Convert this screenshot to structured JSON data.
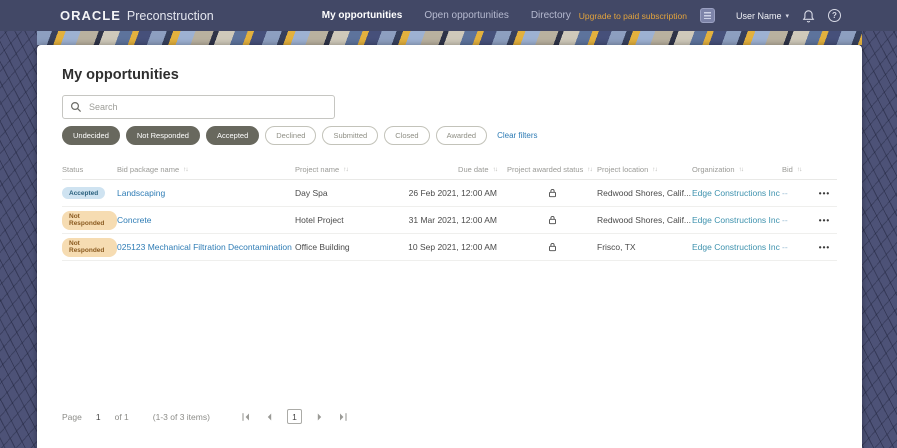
{
  "header": {
    "logo_oracle": "ORACLE",
    "logo_product": "Preconstruction",
    "nav": [
      {
        "label": "My opportunities",
        "active": true
      },
      {
        "label": "Open opportunities",
        "active": false
      },
      {
        "label": "Directory",
        "active": false
      }
    ],
    "upgrade_link": "Upgrade to paid subscription",
    "user_name": "User Name"
  },
  "page": {
    "title": "My opportunities",
    "search_placeholder": "Search",
    "filters": [
      {
        "label": "Undecided",
        "selected": true
      },
      {
        "label": "Not Responded",
        "selected": true
      },
      {
        "label": "Accepted",
        "selected": true
      },
      {
        "label": "Declined",
        "selected": false
      },
      {
        "label": "Submitted",
        "selected": false
      },
      {
        "label": "Closed",
        "selected": false
      },
      {
        "label": "Awarded",
        "selected": false
      }
    ],
    "clear_filters": "Clear filters"
  },
  "table": {
    "columns": [
      "Status",
      "Bid package name",
      "Project name",
      "Due date",
      "Project awarded status",
      "Project location",
      "Organization",
      "Bid"
    ],
    "rows": [
      {
        "status": "Accepted",
        "bid_package": "Landscaping",
        "project": "Day Spa",
        "due": "26 Feb 2021, 12:00 AM",
        "location": "Redwood Shores, Calif...",
        "org": "Edge Constructions Inc",
        "bid": "--"
      },
      {
        "status": "Not Responded",
        "bid_package": "Concrete",
        "project": "Hotel Project",
        "due": "31 Mar 2021, 12:00 AM",
        "location": "Redwood Shores, Calif...",
        "org": "Edge Constructions Inc",
        "bid": "--"
      },
      {
        "status": "Not Responded",
        "bid_package": "025123 Mechanical Filtration Decontamination",
        "project": "Office Building",
        "due": "10 Sep 2021, 12:00 AM",
        "location": "Frisco, TX",
        "org": "Edge Constructions Inc",
        "bid": "--"
      }
    ]
  },
  "pagination": {
    "page_label": "Page",
    "current_page": "1",
    "of_label": "of 1",
    "items_label": "(1-3 of 3 items)"
  },
  "icons": {
    "sort": "↑↓",
    "ellipsis": "•••",
    "caret_down": "▾",
    "help": "?"
  },
  "colors": {
    "topbar": "#424866",
    "accent_yellow": "#e2a33d",
    "link_blue": "#2e7cb5",
    "link_teal": "#3e92ae",
    "badge_accepted_bg": "#cfe3f1",
    "badge_not_responded_bg": "#f6dcb2"
  }
}
